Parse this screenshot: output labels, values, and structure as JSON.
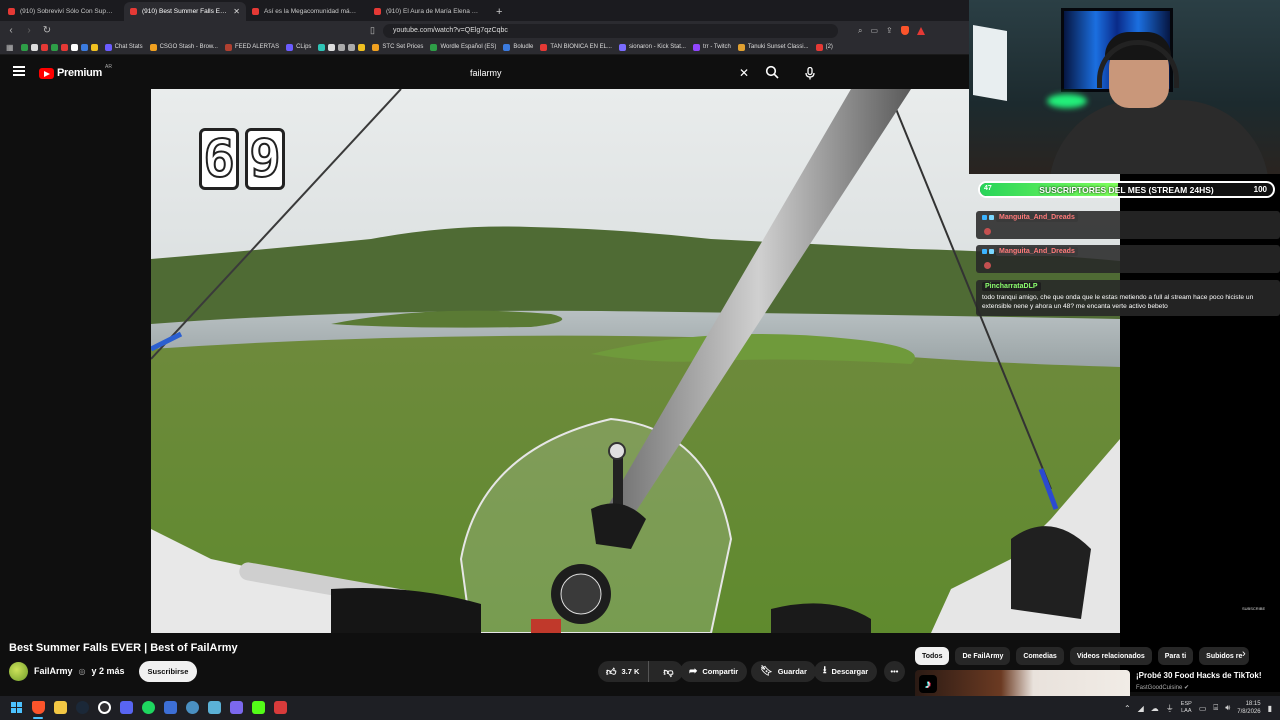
{
  "browser": {
    "tabs": [
      {
        "title": "(910) Sobreviví Sólo Con Supermerca",
        "active": false
      },
      {
        "title": "(910) Best Summer Falls EVER",
        "active": true
      },
      {
        "title": "Así es la Megacomunidad más Densa",
        "active": false
      },
      {
        "title": "(910) El Aura de María Elena Fuseneo",
        "active": false
      }
    ],
    "url": "youtube.com/watch?v=QElg7qzCqbc",
    "bookmarks": [
      {
        "label": "Chat Stats",
        "color": "#6b5cff"
      },
      {
        "label": "CSGO Stash - Brow...",
        "color": "#f0a020"
      },
      {
        "label": "FEED ALERTAS",
        "color": "#b04030"
      },
      {
        "label": "CLips",
        "color": "#6b5cff"
      },
      {
        "label": "STC Set Prices",
        "color": "#f0a020"
      },
      {
        "label": "Wordle Español (ES)",
        "color": "#2e9e47"
      },
      {
        "label": "Boludle",
        "color": "#3b7be0"
      },
      {
        "label": "TAN BIONICA EN EL...",
        "color": "#e53935"
      },
      {
        "label": "sionaron - Kick Stat...",
        "color": "#7a6cff"
      },
      {
        "label": "trr - Twitch",
        "color": "#9146ff"
      },
      {
        "label": "Tanuki Sunset Classi...",
        "color": "#e0a030"
      },
      {
        "label": "(2)",
        "color": "#e53935"
      }
    ]
  },
  "youtube": {
    "brand": "Premium",
    "region": "AR",
    "search_value": "failarmy",
    "video": {
      "counter_digits": [
        "6",
        "9"
      ],
      "subscribe_watermark": "SUBSCRIBE",
      "title": "Best Summer Falls EVER | Best of FailArmy",
      "channel": "FailArmy",
      "channel_more": "y 2 más",
      "subscribe_label": "Suscribirse",
      "likes": "3.7 K",
      "share_label": "Compartir",
      "save_label": "Guardar",
      "download_label": "Descargar",
      "more_label": "•••"
    },
    "chips": [
      {
        "label": "Todos",
        "active": true
      },
      {
        "label": "De FailArmy",
        "active": false
      },
      {
        "label": "Comedias",
        "active": false
      },
      {
        "label": "Videos relacionados",
        "active": false
      },
      {
        "label": "Para ti",
        "active": false
      },
      {
        "label": "Subidos re",
        "active": false
      }
    ],
    "recommendation": {
      "title": "¡Probé 30 Food Hacks de TikTok!",
      "channel": "FastGoodCuisine"
    }
  },
  "stream_overlay": {
    "goal": {
      "current": "47",
      "title": "SUSCRIPTORES DEL MES (STREAM 24HS)",
      "target": "100",
      "progress_fraction": 0.47,
      "fill_color": "#29d45a"
    },
    "chat": [
      {
        "user": "Manguita_And_Dreads",
        "user_color": "#ff7a7a",
        "text": ""
      },
      {
        "user": "Manguita_And_Dreads",
        "user_color": "#ff7a7a",
        "text": ""
      },
      {
        "user": "PincharrataDLP",
        "user_color": "#8cff6e",
        "text": "todo tranqui amigo, che que onda que le estas metiendo a full al stream hace poco hiciste un extensible nene y ahora un 48? me encanta verte activo bebeto"
      }
    ]
  },
  "taskbar": {
    "language": [
      "ESP",
      "LAA"
    ],
    "time": "18:15",
    "date": "7/8/2026"
  }
}
